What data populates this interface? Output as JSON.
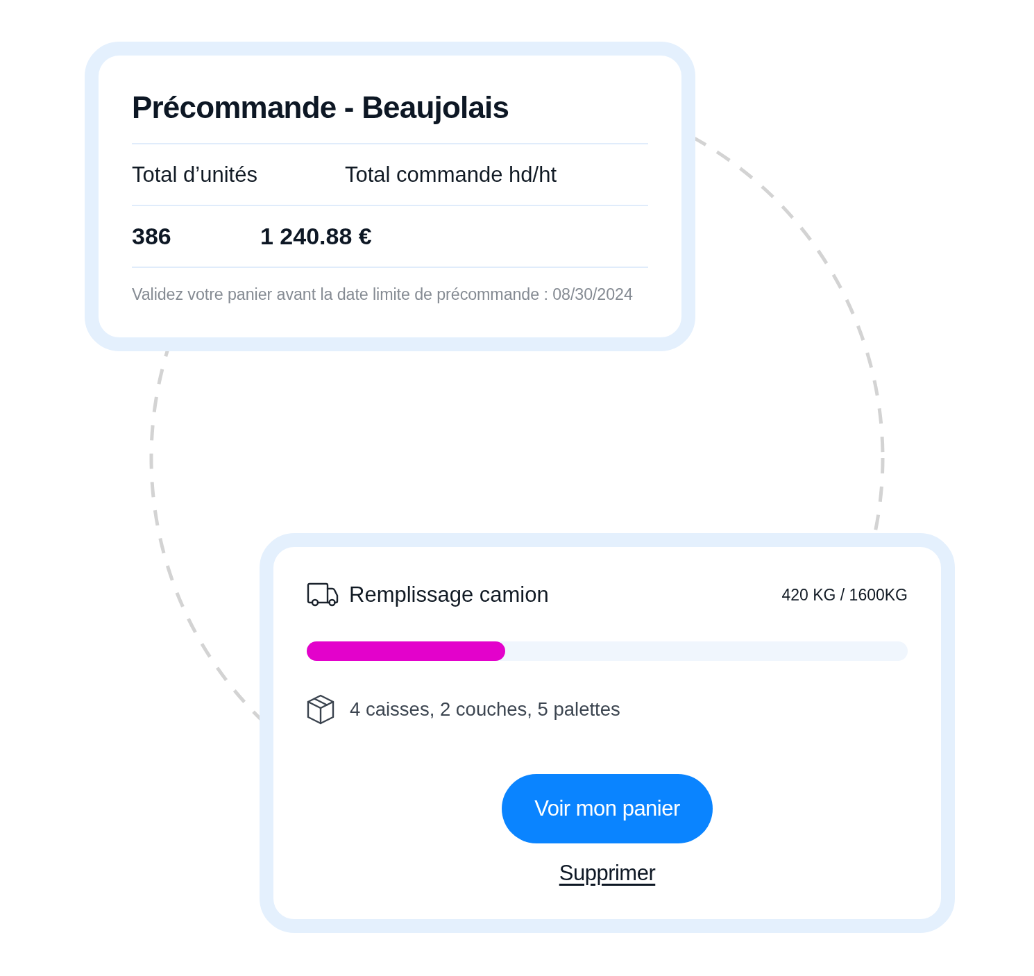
{
  "preorder_card": {
    "title": "Précommande - Beaujolais",
    "labels": [
      "Total d’unités",
      "Total commande hd/ht"
    ],
    "values": [
      "386",
      "1 240.88 €"
    ],
    "note": "Validez votre panier avant la date limite de précommande : 08/30/2024"
  },
  "truck_card": {
    "title": "Remplissage camion",
    "weight": "420 KG / 1600KG",
    "progress": {
      "level": 0.33
    },
    "packaging": "4 caisses, 2 couches, 5 palettes",
    "primary_button": "Voir mon panier",
    "link": "Supprimer"
  }
}
